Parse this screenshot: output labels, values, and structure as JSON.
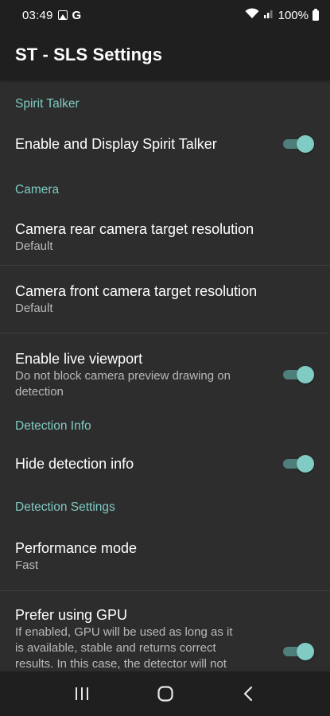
{
  "status_bar": {
    "time": "03:49",
    "battery": "100%",
    "icons": [
      "image-icon",
      "google-icon",
      "wifi-icon",
      "signal-icon",
      "battery-icon"
    ]
  },
  "app_bar": {
    "title": "ST - SLS Settings"
  },
  "sections": {
    "spirit_talker": {
      "header": "Spirit Talker",
      "enable_display": {
        "title": "Enable and Display Spirit Talker",
        "checked": true
      }
    },
    "camera": {
      "header": "Camera",
      "rear_resolution": {
        "title": "Camera rear camera target resolution",
        "summary": "Default"
      },
      "front_resolution": {
        "title": "Camera front camera target resolution",
        "summary": "Default"
      },
      "live_viewport": {
        "title": "Enable live viewport",
        "summary": "Do not block camera preview drawing on detection",
        "checked": true
      }
    },
    "detection_info": {
      "header": "Detection Info",
      "hide_info": {
        "title": "Hide detection info",
        "checked": true
      }
    },
    "detection_settings": {
      "header": "Detection Settings",
      "performance_mode": {
        "title": "Performance mode",
        "summary": "Fast"
      },
      "prefer_gpu": {
        "title": "Prefer using GPU",
        "summary": "If enabled, GPU will be used as long as it is available, stable and returns correct results. In this case, the detector will not",
        "checked": true
      }
    }
  },
  "colors": {
    "accent": "#80cbc4",
    "background": "#2d2d2d",
    "bar": "#1f1f1f"
  },
  "nav_bar": {
    "icons": [
      "recents-icon",
      "home-icon",
      "back-icon"
    ]
  }
}
